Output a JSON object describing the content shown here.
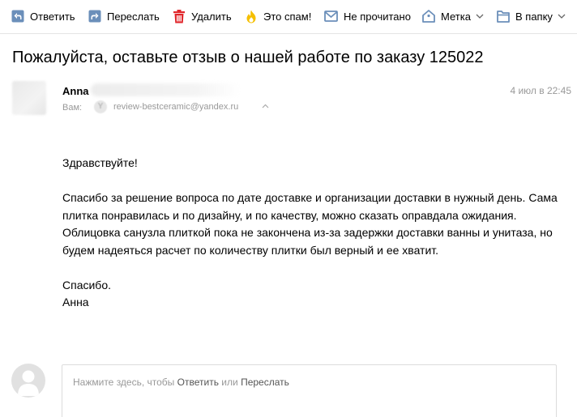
{
  "toolbar": {
    "reply": "Ответить",
    "forward": "Переслать",
    "delete": "Удалить",
    "spam": "Это спам!",
    "unread": "Не прочитано",
    "label": "Метка",
    "folder": "В папку"
  },
  "message": {
    "subject": "Пожалуйста, оставьте отзыв о нашей работе по заказу 125022",
    "from_name": "Anna",
    "to_label": "Вам:",
    "to_address": "review-bestceramic@yandex.ru",
    "date": "4 июл в 22:45",
    "body": {
      "greeting": "Здравствуйте!",
      "paragraph": "Спасибо за решение вопроса по дате доставке и организации доставки в нужный день. Сама плитка понравилась и по дизайну, и по качеству, можно сказать оправдала ожидания. Облицовка санузла плиткой пока не закончена из-за задержки доставки ванны и унитаза, но будем надеяться расчет по количеству плитки был верный и ее хватит.",
      "thanks": "Спасибо.",
      "signature": "Анна"
    }
  },
  "quick_reply": {
    "prefix": "Нажмите здесь, чтобы",
    "reply_link": "Ответить",
    "or": "или",
    "forward_link": "Переслать"
  },
  "colors": {
    "icon_blue": "#6b8fba",
    "icon_red": "#e0262b",
    "icon_yellow": "#f5bf00",
    "muted_text": "#999999"
  },
  "icons": {
    "reply": "reply-icon",
    "forward": "forward-icon",
    "delete": "trash-icon",
    "spam": "fire-icon",
    "unread": "envelope-icon",
    "label": "tag-icon",
    "folder": "folder-icon"
  }
}
